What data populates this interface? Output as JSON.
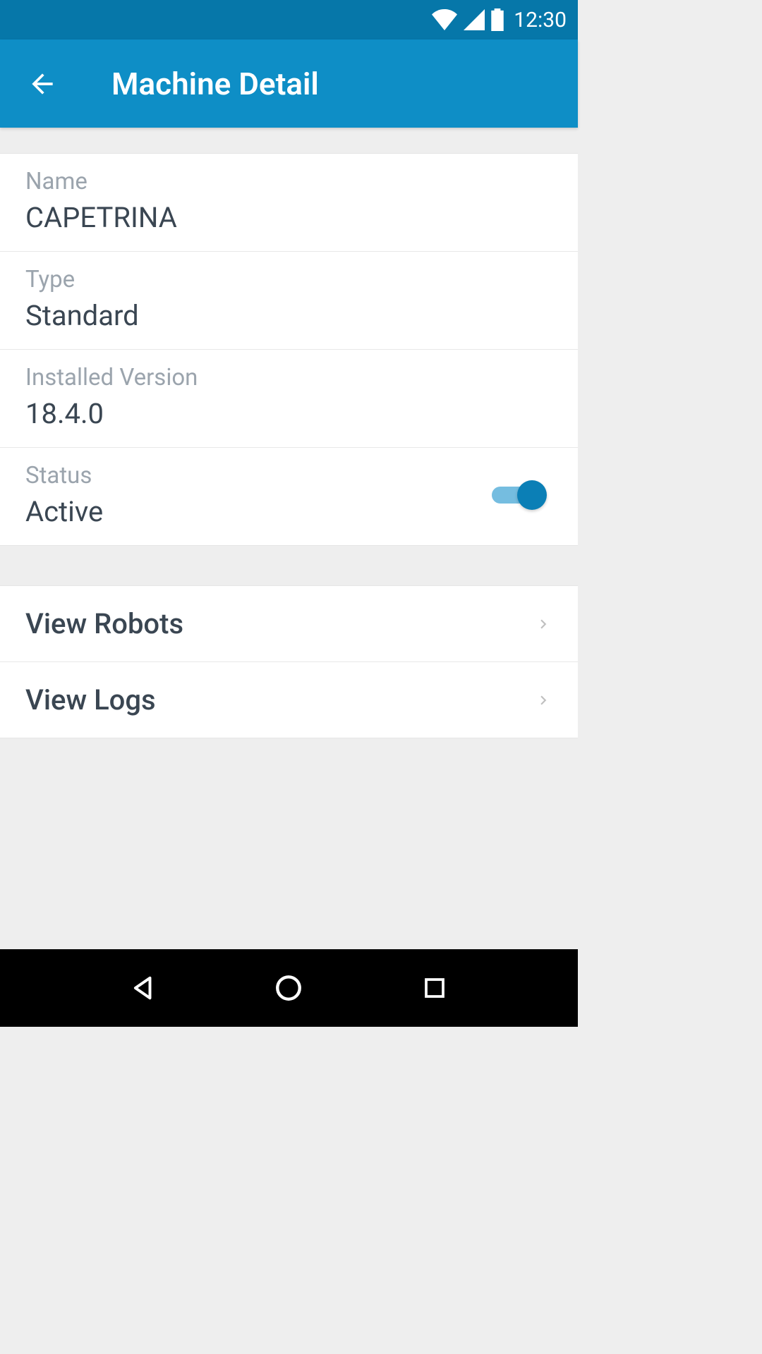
{
  "statusBar": {
    "time": "12:30"
  },
  "header": {
    "title": "Machine Detail"
  },
  "fields": {
    "name": {
      "label": "Name",
      "value": "CAPETRINA"
    },
    "type": {
      "label": "Type",
      "value": "Standard"
    },
    "installedVersion": {
      "label": "Installed Version",
      "value": "18.4.0"
    },
    "status": {
      "label": "Status",
      "value": "Active",
      "toggled": true
    }
  },
  "actions": {
    "viewRobots": "View Robots",
    "viewLogs": "View Logs"
  }
}
